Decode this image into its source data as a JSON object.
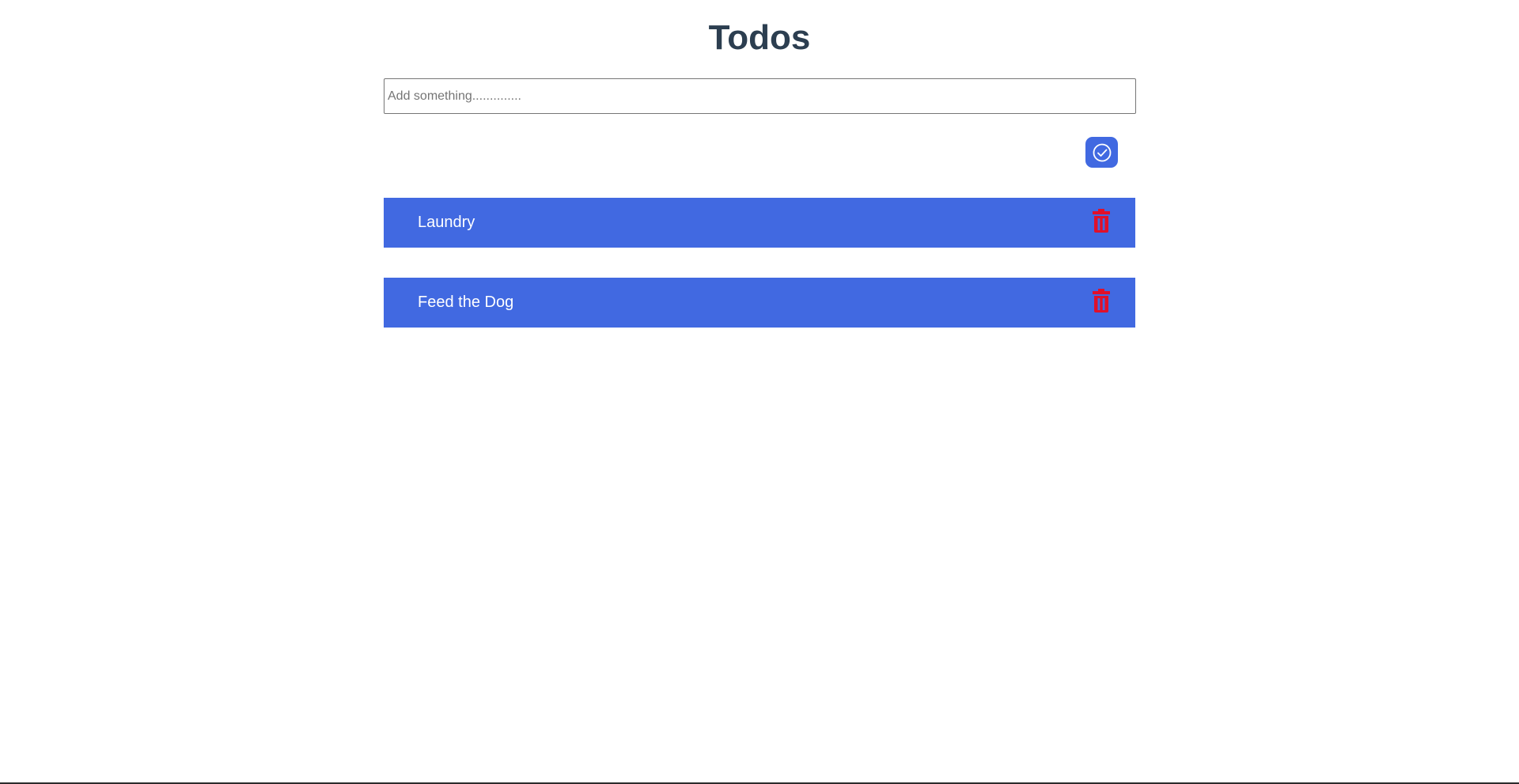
{
  "header": {
    "title": "Todos"
  },
  "input": {
    "placeholder": "Add something..............",
    "value": ""
  },
  "add_button": {
    "icon": "check-circle-icon",
    "color": "#4169e1"
  },
  "todos": [
    {
      "label": "Laundry",
      "delete_icon": "trash-icon"
    },
    {
      "label": "Feed the Dog",
      "delete_icon": "trash-icon"
    }
  ],
  "colors": {
    "title": "#2c3e50",
    "item_background": "#4169e1",
    "item_text": "#ffffff",
    "delete_icon": "#e0102a"
  }
}
